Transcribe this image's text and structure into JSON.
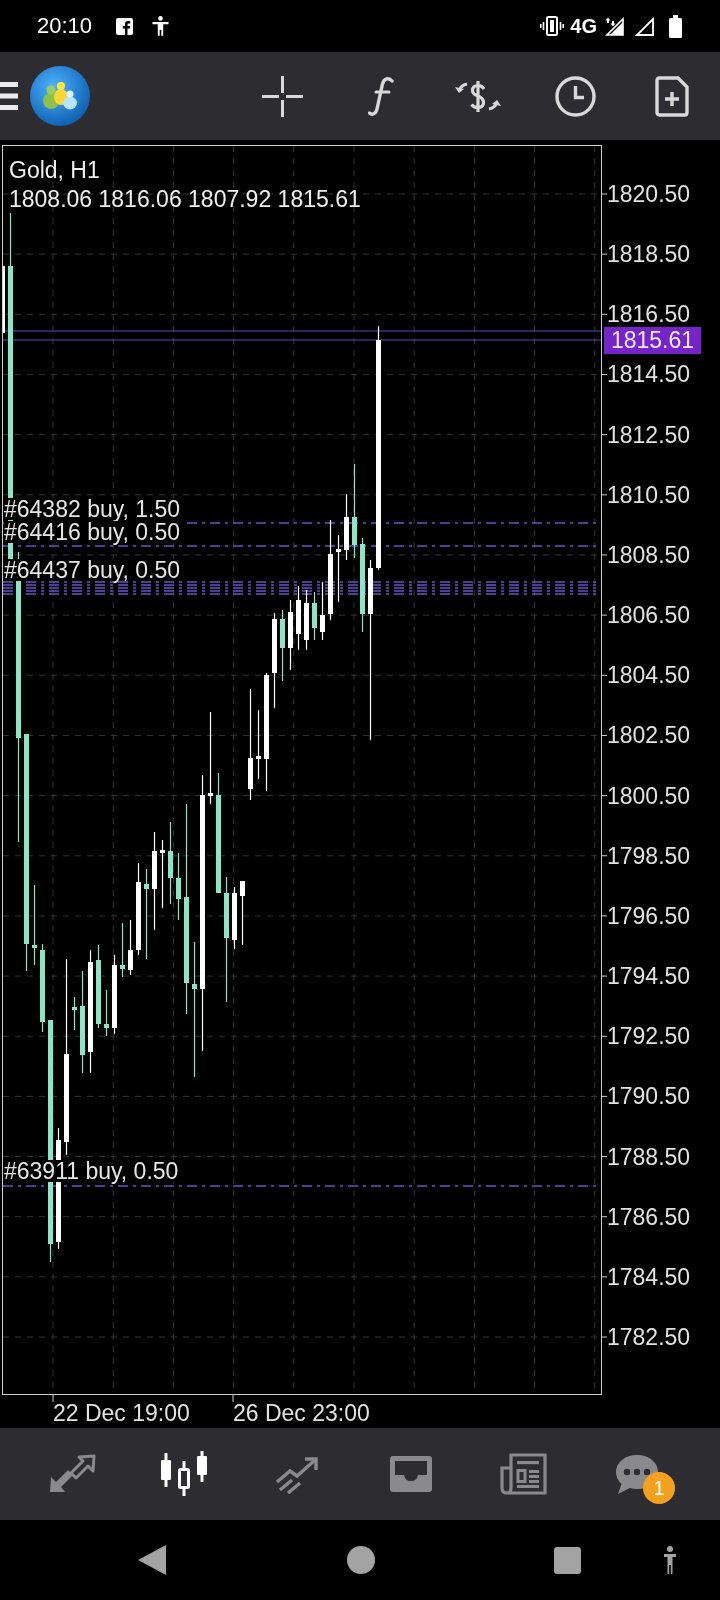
{
  "status_bar": {
    "time": "20:10",
    "network": "4G"
  },
  "chart": {
    "title": "Gold, H1",
    "ohlc": "1808.06 1816.06 1807.92 1815.61",
    "price_labels": [
      "1820.50",
      "1818.50",
      "1816.50",
      "1814.50",
      "1812.50",
      "1810.50",
      "1808.50",
      "1806.50",
      "1804.50",
      "1802.50",
      "1800.50",
      "1798.50",
      "1796.50",
      "1794.50",
      "1792.50",
      "1790.50",
      "1788.50",
      "1786.50",
      "1784.50",
      "1782.50"
    ],
    "current_price": "1815.61",
    "orders": [
      {
        "label": "#64382 buy, 1.50"
      },
      {
        "label": "#64416 buy, 0.50"
      },
      {
        "label": "#64437 buy, 0.50"
      },
      {
        "label": "#63911 buy, 0.50"
      }
    ],
    "time_labels": [
      "22 Dec 19:00",
      "26 Dec 23:00"
    ]
  },
  "bottom_nav": {
    "items": [
      {
        "selected": false
      },
      {
        "selected": true
      },
      {
        "selected": false
      },
      {
        "selected": false
      },
      {
        "selected": false
      },
      {
        "selected": false,
        "badge": "1"
      }
    ]
  }
}
